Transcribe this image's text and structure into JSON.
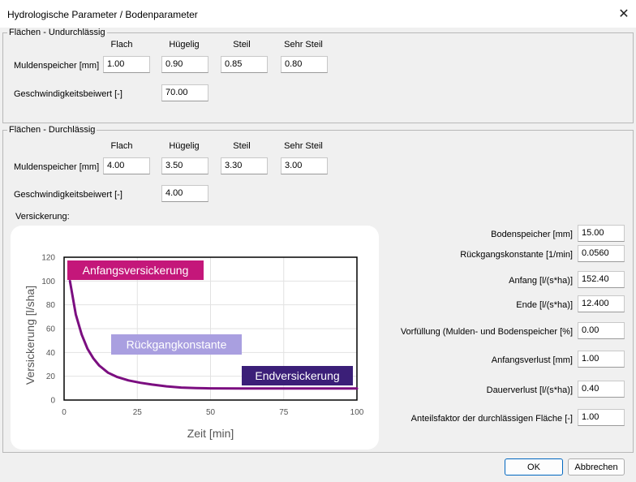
{
  "window": {
    "title": "Hydrologische Parameter / Bodenparameter",
    "close": "✕"
  },
  "impervious": {
    "legend": "Flächen - Undurchlässig",
    "columns": [
      "Flach",
      "Hügelig",
      "Steil",
      "Sehr Steil"
    ],
    "mulden_label": "Muldenspeicher [mm]",
    "mulden_values": [
      "1.00",
      "0.90",
      "0.85",
      "0.80"
    ],
    "geschw_label": "Geschwindigkeitsbeiwert [-]",
    "geschw_value": "70.00"
  },
  "pervious": {
    "legend": "Flächen - Durchlässig",
    "columns": [
      "Flach",
      "Hügelig",
      "Steil",
      "Sehr Steil"
    ],
    "mulden_label": "Muldenspeicher [mm]",
    "mulden_values": [
      "4.00",
      "3.50",
      "3.30",
      "3.00"
    ],
    "geschw_label": "Geschwindigkeitsbeiwert [-]",
    "geschw_value": "4.00",
    "versickerung_label": "Versickerung:"
  },
  "params": [
    {
      "label": "Bodenspeicher [mm]",
      "value": "15.00"
    },
    {
      "label": "Rückgangskonstante [1/min]",
      "value": "0.0560"
    },
    {
      "label": "Anfang [l/(s*ha)]",
      "value": "152.40"
    },
    {
      "label": "Ende [l/(s*ha)]",
      "value": "12.400"
    },
    {
      "label": "Vorfüllung (Mulden- und Bodenspeicher [%]",
      "value": "0.00"
    },
    {
      "label": "Anfangsverlust [mm]",
      "value": "1.00"
    },
    {
      "label": "Dauerverlust [l/(s*ha)]",
      "value": "0.40"
    },
    {
      "label": "Anteilsfaktor der durchlässigen Fläche [-]",
      "value": "1.00"
    }
  ],
  "buttons": {
    "ok": "OK",
    "cancel": "Abbrechen"
  },
  "chart_data": {
    "type": "line",
    "xlabel": "Zeit [min]",
    "ylabel": "Versickerung [l/sha]",
    "xlim": [
      0,
      100
    ],
    "ylim": [
      0,
      120
    ],
    "xticks": [
      "0",
      "25",
      "50",
      "75",
      "100"
    ],
    "yticks": [
      "0",
      "20",
      "40",
      "60",
      "80",
      "100",
      "120"
    ],
    "grid": true,
    "line_color": "#7b0e80",
    "series": [
      {
        "x": [
          2,
          4,
          6,
          8,
          10,
          12,
          15,
          18,
          22,
          26,
          30,
          35,
          40,
          45,
          50,
          60,
          70,
          80,
          90,
          100
        ],
        "y": [
          100,
          72,
          55,
          43,
          35,
          29,
          23,
          19.5,
          16.5,
          14.5,
          13,
          11.5,
          10.5,
          10,
          9.8,
          9.7,
          9.7,
          9.7,
          9.7,
          9.7
        ]
      }
    ],
    "annotations": [
      {
        "text": "Anfangsversickerung",
        "color": "#c4177a"
      },
      {
        "text": "Rückgangkonstante",
        "color": "#a99fe0"
      },
      {
        "text": "Endversickerung",
        "color": "#3b1f78"
      }
    ]
  }
}
